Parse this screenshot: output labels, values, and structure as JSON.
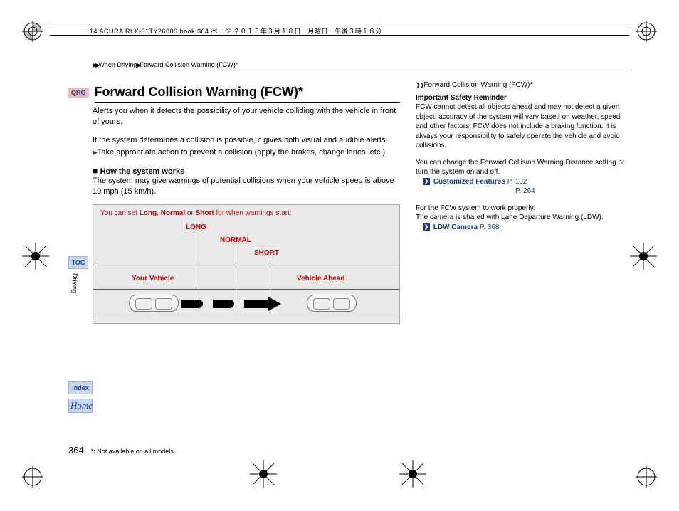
{
  "header": "14 ACURA RLX-31TY26000.book  364 ページ  ２０１３年３月１８日　月曜日　午後３時１８分",
  "breadcrumb": {
    "a": "When Driving",
    "b": "Forward Collision Warning (FCW)*"
  },
  "qrg": "QRG",
  "title": "Forward Collision Warning (FCW)*",
  "intro": "Alerts you when it detects the possibility of your vehicle colliding with the vehicle in front of yours.",
  "para2": "If the system determines a collision is possible, it gives both visual and audible alerts.",
  "para2b": "Take appropriate action to prevent a collision (apply the brakes, change lanes, etc.).",
  "subhead": "How the system works",
  "para3": "The system may give warnings of potential collisions when your vehicle speed is above 10 mph (15 km/h).",
  "diagram": {
    "caption_pre": "You can set ",
    "w1": "Long",
    "sep1": ", ",
    "w2": "Normal",
    "sep2": " or ",
    "w3": "Short",
    "caption_post": " for when warnings start:",
    "long": "LONG",
    "normal": "NORMAL",
    "short": "SHORT",
    "your": "Your Vehicle",
    "ahead": "Vehicle Ahead"
  },
  "side": {
    "title": "Forward Collision Warning (FCW)*",
    "h1": "Important Safety Reminder",
    "p1": "FCW cannot detect all objects ahead and may not detect a given object; accuracy of the system will vary based on weather, speed and other factors. FCW does not include a braking function. It is always your responsibility to safely operate the vehicle and avoid collisions.",
    "p2": "You can change the Forward Collision Warning Distance setting or turn the system on and off.",
    "link1": "Customized Features",
    "link1p": "P. 102",
    "link1p2": "P. 264",
    "p3": "For the FCW system to work properly:",
    "p3b": "The camera is shared with Lane Departure Warning (LDW).",
    "link2": "LDW Camera",
    "link2p": "P. 368"
  },
  "nav": {
    "toc": "TOC",
    "driving": "Driving",
    "index": "Index",
    "home": "Home"
  },
  "footer": {
    "page": "364",
    "note": "*: Not available on all models"
  }
}
